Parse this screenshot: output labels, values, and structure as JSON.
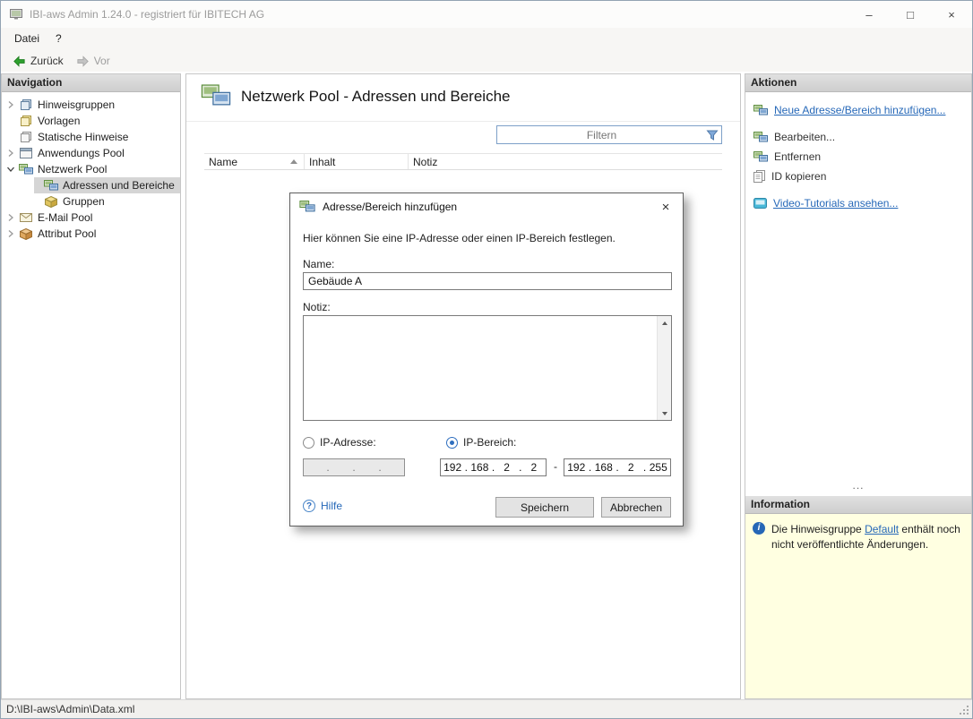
{
  "window": {
    "title": "IBI-aws Admin 1.24.0 - registriert für IBITECH AG",
    "controls": {
      "minimize": "–",
      "maximize": "□",
      "close": "×"
    }
  },
  "menubar": {
    "items": [
      {
        "label": "Datei"
      },
      {
        "label": "?"
      }
    ]
  },
  "toolbar": {
    "back": "Zurück",
    "forward": "Vor"
  },
  "navigation": {
    "header": "Navigation",
    "items": [
      {
        "label": "Hinweisgruppen"
      },
      {
        "label": "Vorlagen"
      },
      {
        "label": "Statische Hinweise"
      },
      {
        "label": "Anwendungs Pool"
      },
      {
        "label": "Netzwerk Pool"
      },
      {
        "label": "Adressen und Bereiche",
        "selected": true
      },
      {
        "label": "Gruppen"
      },
      {
        "label": "E-Mail Pool"
      },
      {
        "label": "Attribut Pool"
      }
    ]
  },
  "main": {
    "title": "Netzwerk Pool - Adressen und Bereiche",
    "filter_placeholder": "Filtern",
    "columns": [
      {
        "label": "Name",
        "sorted": "asc"
      },
      {
        "label": "Inhalt"
      },
      {
        "label": "Notiz"
      }
    ],
    "rows": []
  },
  "dialog": {
    "title": "Adresse/Bereich hinzufügen",
    "close": "×",
    "description": "Hier können Sie eine IP-Adresse oder einen IP-Bereich festlegen.",
    "name_label": "Name:",
    "name_value": "Gebäude A",
    "note_label": "Notiz:",
    "note_value": "",
    "ip_address_label": "IP-Adresse:",
    "ip_range_label": "IP-Bereich:",
    "ip_separator": ".",
    "range_start": [
      "192",
      "168",
      "2",
      "2"
    ],
    "range_end": [
      "192",
      "168",
      "2",
      "255"
    ],
    "range_dash": "-",
    "help_icon": "?",
    "help_label": "Hilfe",
    "save_label": "Speichern",
    "cancel_label": "Abbrechen"
  },
  "actions": {
    "header": "Aktionen",
    "splitter_dots": "...",
    "items": [
      {
        "label": "Neue Adresse/Bereich hinzufügen..."
      },
      {
        "label": "Bearbeiten..."
      },
      {
        "label": "Entfernen"
      },
      {
        "label": "ID kopieren"
      },
      {
        "label": "Video-Tutorials ansehen..."
      }
    ]
  },
  "information": {
    "header": "Information",
    "icon": "i",
    "text_before": "Die Hinweisgruppe ",
    "link": "Default",
    "text_after": " enthält noch nicht veröffentlichte Änderungen."
  },
  "statusbar": {
    "path": "D:\\IBI-aws\\Admin\\Data.xml"
  }
}
